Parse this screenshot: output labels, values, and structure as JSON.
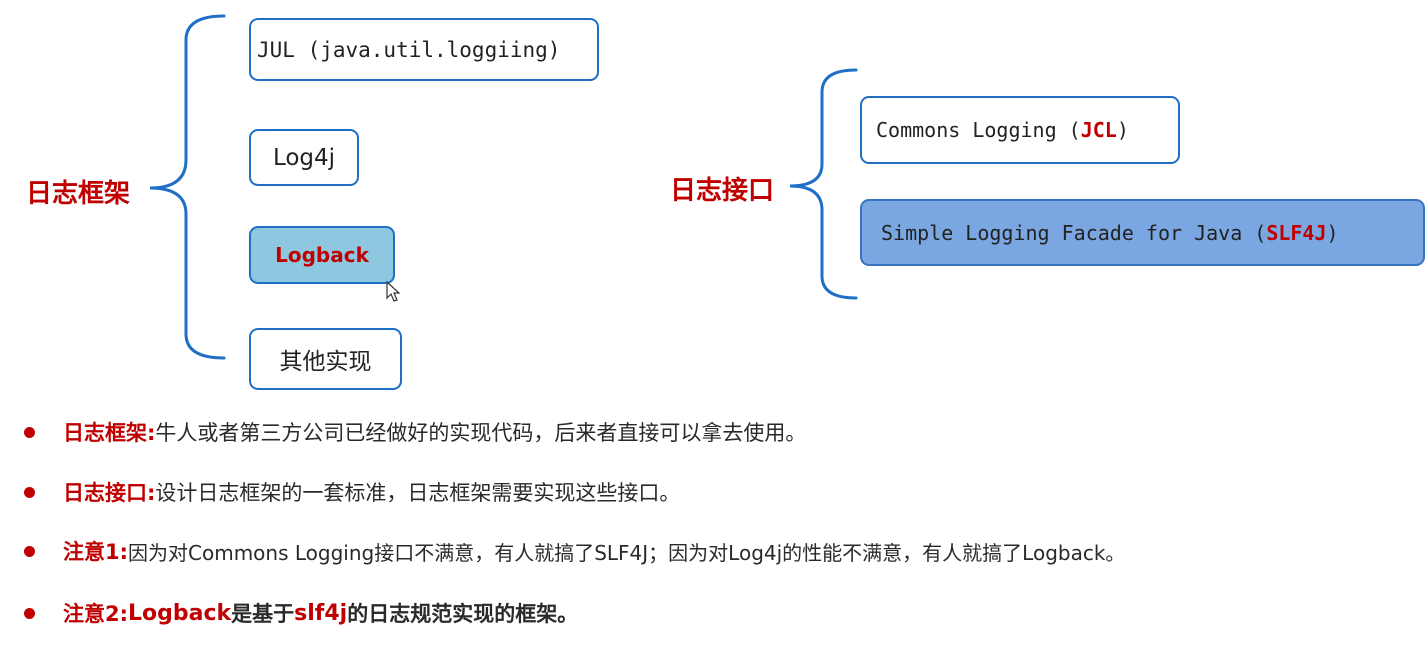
{
  "frameworks": {
    "label": "日志框架",
    "items": {
      "jul": "JUL (java.util.loggiing)",
      "log4j": "Log4j",
      "logback": "Logback",
      "other": "其他实现"
    }
  },
  "interfaces": {
    "label": "日志接口",
    "jcl": {
      "prefix": "Commons Logging (",
      "abbr": "JCL",
      "suffix": ")"
    },
    "slf4j": {
      "prefix": "Simple Logging Facade for Java (",
      "abbr": "SLF4J",
      "suffix": ")"
    }
  },
  "bullets": {
    "b1": {
      "term": "日志框架:",
      "text": "牛人或者第三方公司已经做好的实现代码，后来者直接可以拿去使用。"
    },
    "b2": {
      "term": "日志接口:",
      "text": "设计日志框架的一套标准，日志框架需要实现这些接口。"
    },
    "b3": {
      "term": "注意1:",
      "text": "因为对Commons Logging接口不满意，有人就搞了SLF4J；因为对Log4j的性能不满意，有人就搞了Logback。"
    },
    "b4": {
      "term": "注意2:",
      "part1": "Logback",
      "part2": "是基于",
      "part3": "slf4j",
      "part4": "的日志规范实现的框架。"
    }
  },
  "colors": {
    "accent_red": "#c00000",
    "border_blue": "#1f6fc5",
    "highlight_fill": "#8ec8e0",
    "slf4j_fill": "#7aa6e2"
  },
  "icons": {
    "cursor": "mouse-pointer-icon"
  }
}
